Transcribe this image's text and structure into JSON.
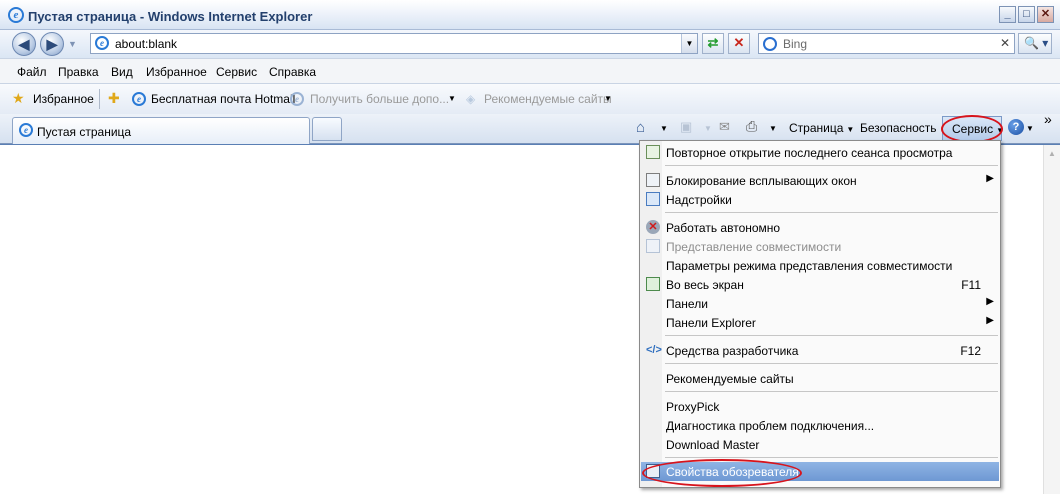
{
  "window": {
    "title": "Пустая страница - Windows Internet Explorer",
    "buttons": {
      "minimize": "_",
      "maximize": "□",
      "close": "✕"
    }
  },
  "address_bar": {
    "url": "about:blank",
    "back": "◀",
    "forward": "▶",
    "refresh": "⇄",
    "stop": "✕"
  },
  "search": {
    "placeholder": "Bing",
    "go": "🔍 ▾"
  },
  "menubar": {
    "items": [
      "Файл",
      "Правка",
      "Вид",
      "Избранное",
      "Сервис",
      "Справка"
    ]
  },
  "favorites_bar": {
    "favorites_label": "Избранное",
    "links": [
      {
        "label": "Бесплатная почта Hotmail",
        "enabled": true
      },
      {
        "label": "Получить больше допо...",
        "enabled": false
      },
      {
        "label": "Рекомендуемые сайты",
        "enabled": false
      }
    ]
  },
  "tabs": [
    {
      "label": "Пустая страница",
      "active": true
    }
  ],
  "command_bar": {
    "page": "Страница",
    "safety": "Безопасность",
    "tools": "Сервис",
    "help": "?",
    "chevron": "»"
  },
  "tools_menu": {
    "items": [
      {
        "label": "Повторное открытие последнего сеанса просмотра",
        "icon": "reopen-session-icon",
        "enabled": true
      },
      {
        "label": "Блокирование всплывающих окон",
        "icon": "popup-blocker-icon",
        "enabled": true,
        "submenu": true
      },
      {
        "label": "Надстройки",
        "icon": "add-ons-icon",
        "enabled": true
      },
      {
        "label": "Работать автономно",
        "icon": "offline-icon",
        "enabled": true
      },
      {
        "label": "Представление совместимости",
        "icon": "compatibility-view-icon",
        "enabled": false
      },
      {
        "label": "Параметры режима представления совместимости",
        "enabled": true
      },
      {
        "label": "Во весь экран",
        "icon": "full-screen-icon",
        "shortcut": "F11",
        "enabled": true
      },
      {
        "label": "Панели",
        "enabled": true,
        "submenu": true
      },
      {
        "label": "Панели Explorer",
        "enabled": true,
        "submenu": true
      },
      {
        "label": "Средства разработчика",
        "icon": "developer-tools-icon",
        "shortcut": "F12",
        "enabled": true
      },
      {
        "label": "Рекомендуемые сайты",
        "enabled": true
      },
      {
        "label": "ProxyPick",
        "enabled": true
      },
      {
        "label": "Диагностика проблем подключения...",
        "enabled": true
      },
      {
        "label": "Download Master",
        "enabled": true
      },
      {
        "label": "Свойства обозревателя",
        "icon": "internet-options-icon",
        "enabled": true,
        "highlighted": true
      }
    ]
  },
  "colors": {
    "highlight": "#7aa2d9",
    "annotation_oval": "#d7141c"
  }
}
